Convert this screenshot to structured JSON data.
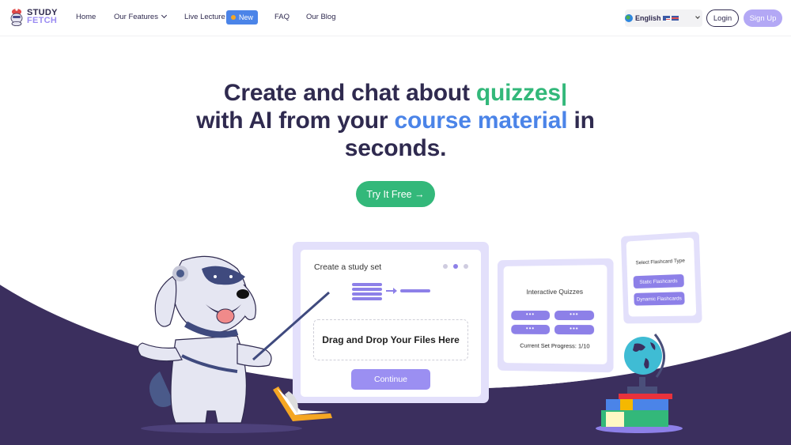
{
  "navbar": {
    "logo": {
      "line1": "STUDY",
      "line2": "FETCH"
    },
    "items": [
      {
        "label": "Home"
      },
      {
        "label": "Our Features"
      },
      {
        "label": "Live Lecture"
      },
      {
        "label": "FAQ"
      },
      {
        "label": "Our Blog"
      }
    ],
    "new_badge": "New",
    "language": {
      "selected": "English"
    },
    "login_label": "Login",
    "signup_label": "Sign Up"
  },
  "hero": {
    "line1_prefix": "Create and chat about ",
    "line1_highlight": "quizzes|",
    "line2_prefix": "with AI from your ",
    "line2_highlight": "course material",
    "line2_suffix": " in",
    "line3": "seconds.",
    "cta_label": "Try It Free →"
  },
  "illustration": {
    "study_set_card": {
      "title": "Create a study set",
      "dropzone_label": "Drag and Drop Your Files Here",
      "continue_label": "Continue",
      "step_total": 3,
      "step_active": 2
    },
    "quiz_card": {
      "title": "Interactive Quizzes",
      "options": [
        "•••",
        "•••",
        "•••",
        "•••"
      ],
      "progress_text": "Current Set Progress: 1/10"
    },
    "flashcard_card": {
      "title": "Select Flashcard Type",
      "options": [
        "Static Flashcards",
        "Dynamic Flashcards"
      ]
    }
  },
  "colors": {
    "dark_navy": "#2f2a4f",
    "green": "#33b87a",
    "blue": "#4b84e8",
    "purple": "#8d80e8",
    "lavender": "#e3e0fb",
    "background_dark": "#3b2f5e"
  }
}
